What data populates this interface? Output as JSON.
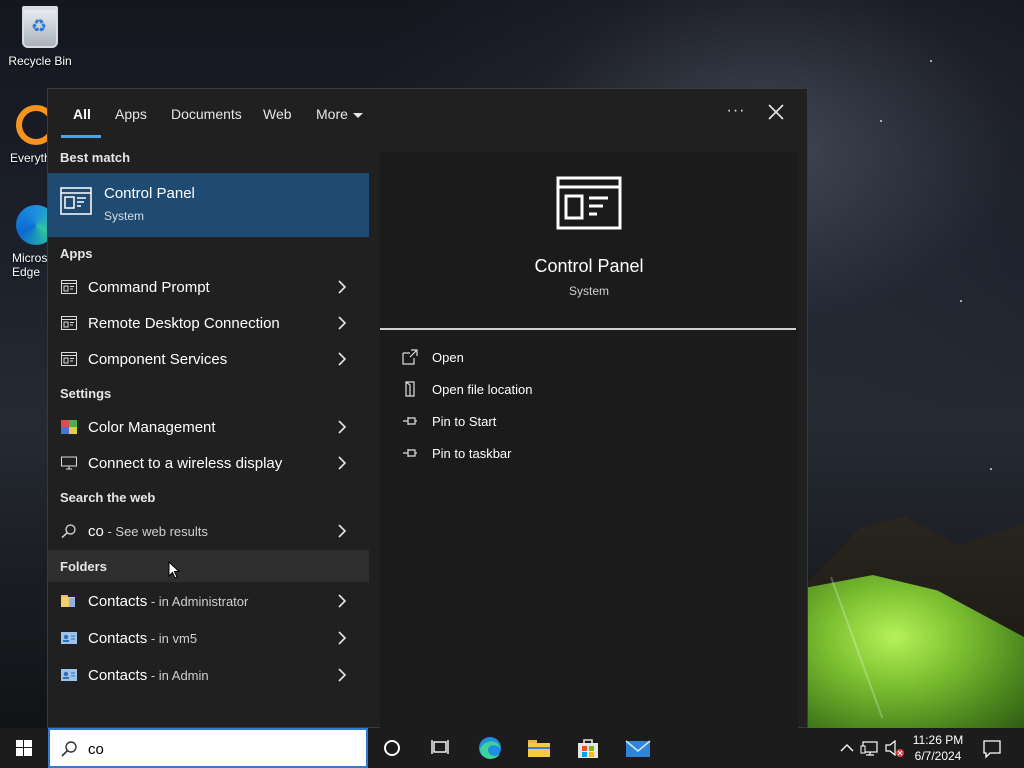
{
  "desktop": {
    "icons": [
      {
        "label": "Recycle Bin"
      },
      {
        "label": "Everyth"
      },
      {
        "label": "Micros\nEdge"
      }
    ]
  },
  "tabs": [
    "All",
    "Apps",
    "Documents",
    "Web",
    "More"
  ],
  "best_match": {
    "heading": "Best match",
    "title": "Control Panel",
    "subtitle": "System"
  },
  "sections": {
    "apps": "Apps",
    "settings": "Settings",
    "web": "Search the web",
    "folders": "Folders"
  },
  "apps": [
    {
      "label": "Command Prompt"
    },
    {
      "label": "Remote Desktop Connection"
    },
    {
      "label": "Component Services"
    }
  ],
  "settings": [
    {
      "label": "Color Management"
    },
    {
      "label": "Connect to a wireless display"
    }
  ],
  "web": {
    "query": "co",
    "suffix": " - See web results"
  },
  "folders": [
    {
      "label": "Contacts",
      "location": " - in Administrator"
    },
    {
      "label": "Contacts",
      "location": " - in vm5"
    },
    {
      "label": "Contacts",
      "location": " - in Admin"
    }
  ],
  "detail": {
    "title": "Control Panel",
    "subtitle": "System",
    "actions": [
      "Open",
      "Open file location",
      "Pin to Start",
      "Pin to taskbar"
    ]
  },
  "search": {
    "value": "co"
  },
  "clock": {
    "time": "11:26 PM",
    "date": "6/7/2024"
  },
  "colors": {
    "accent": "#2f7bd6",
    "selected": "#1f4a72",
    "panel": "#202020"
  }
}
